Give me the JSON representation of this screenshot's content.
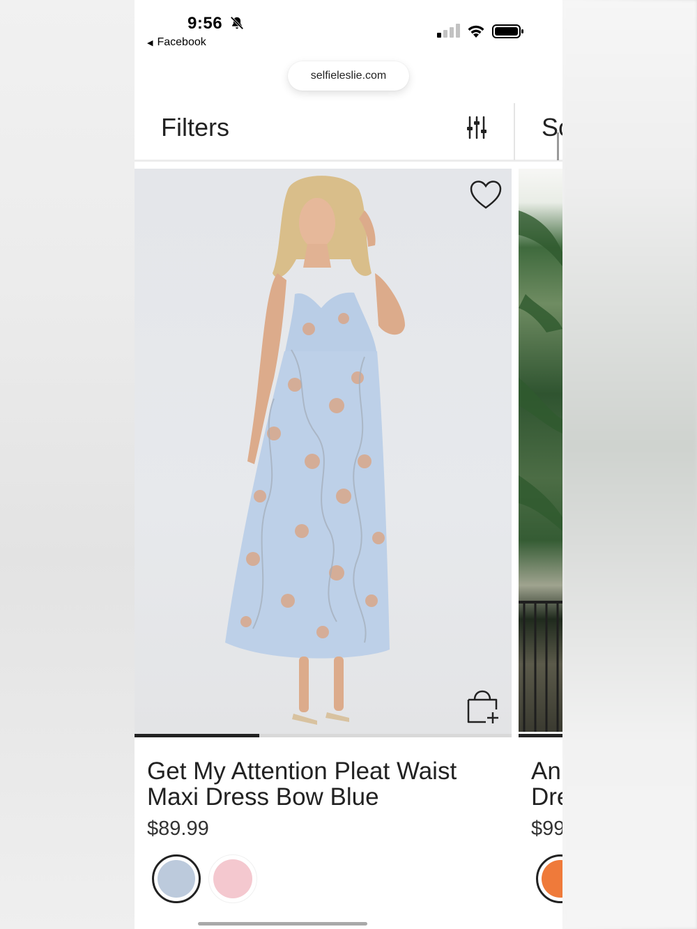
{
  "status_bar": {
    "time": "9:56",
    "back_app": "Facebook",
    "icons": [
      "bell-muted-icon",
      "cellular-signal-icon",
      "wifi-icon",
      "battery-icon"
    ]
  },
  "browser": {
    "url": "selfieleslie.com"
  },
  "toolbar": {
    "filters_label": "Filters",
    "filters_icon": "sliders-icon",
    "sort_label_partial": "So"
  },
  "products": [
    {
      "title": "Get My Attention Pleat Waist Maxi Dress Bow Blue",
      "price": "$89.99",
      "image_progress": 0.33,
      "swatches": [
        {
          "color": "#bccadc",
          "selected": true
        },
        {
          "color": "#f4c8cf",
          "selected": false
        }
      ],
      "icons": [
        "heart-icon",
        "shopping-bag-plus-icon"
      ]
    },
    {
      "title_line1_partial": "An",
      "title_line2_partial": "Dre",
      "price_partial": "$99",
      "swatches": [
        {
          "color": "#ef7a3a",
          "selected": true
        }
      ]
    }
  ]
}
